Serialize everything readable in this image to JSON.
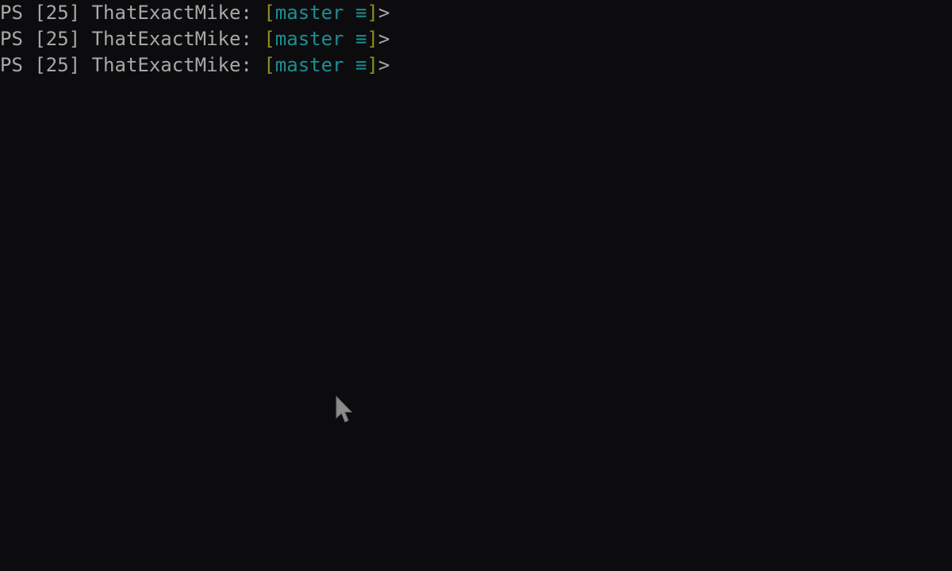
{
  "terminal": {
    "lines": [
      {
        "prefix": "PS [25] ThatExactMike: ",
        "open_bracket": "[",
        "branch": "master",
        "status": " ≡",
        "close_bracket": "]",
        "prompt_end": ">"
      },
      {
        "prefix": "PS [25] ThatExactMike: ",
        "open_bracket": "[",
        "branch": "master",
        "status": " ≡",
        "close_bracket": "]",
        "prompt_end": ">"
      },
      {
        "prefix": "PS [25] ThatExactMike: ",
        "open_bracket": "[",
        "branch": "master",
        "status": " ≡",
        "close_bracket": "]",
        "prompt_end": ">"
      }
    ]
  },
  "colors": {
    "background": "#0c0c0e",
    "text": "#a8a8a8",
    "bracket": "#8f8f1c",
    "branch": "#1d8e93"
  },
  "icons": {
    "mouse_cursor": "arrow-pointer-icon"
  }
}
